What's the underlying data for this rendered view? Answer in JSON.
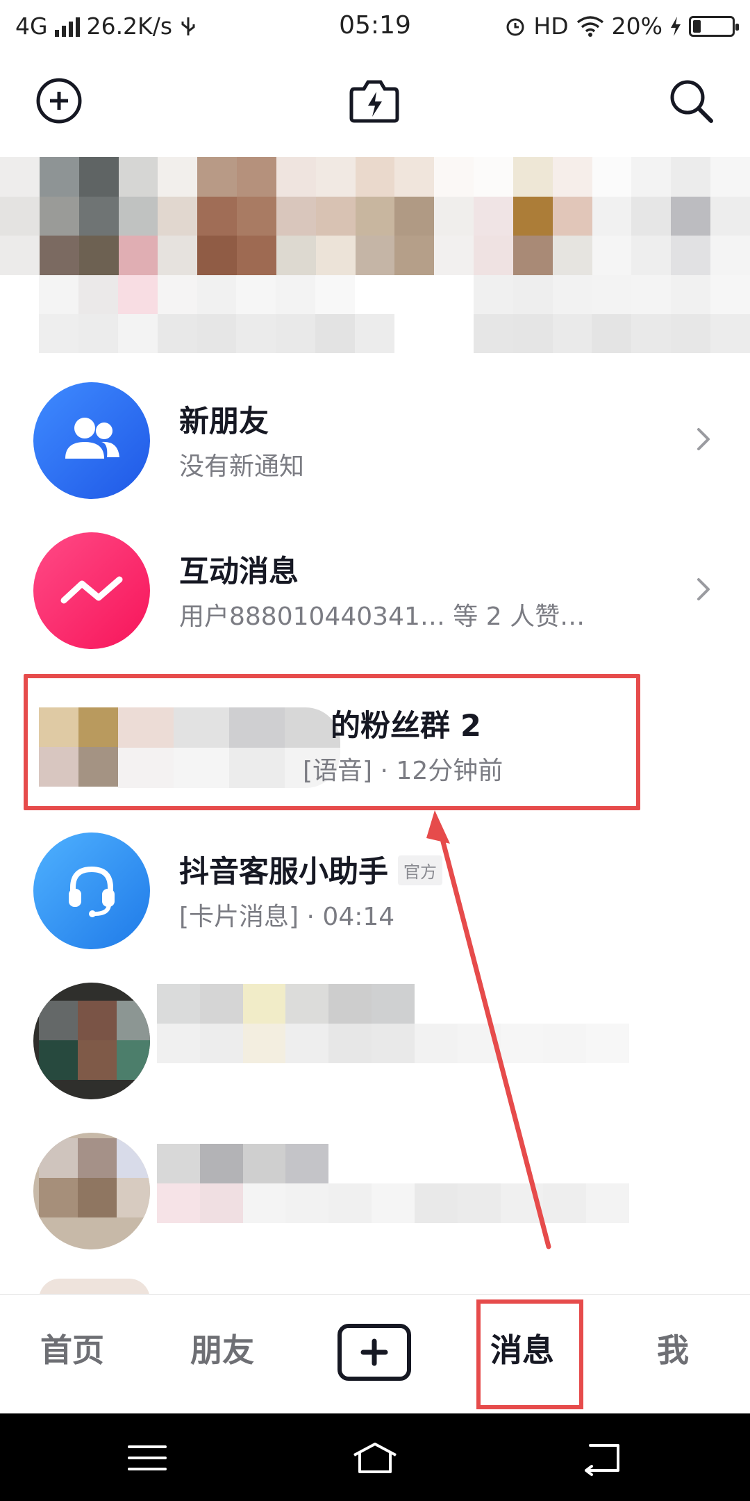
{
  "status_bar": {
    "network": "4G",
    "speed": "26.2K/s",
    "time": "05:19",
    "hd": "HD",
    "battery_percent": "20%",
    "battery_level": 0.2
  },
  "colors": {
    "accent_red": "#e64b4b",
    "new_friends_avatar": "#2f7cf6",
    "interaction_avatar": "#fb2b66",
    "service_avatar": "#2d8cf0"
  },
  "messages": [
    {
      "title": "新朋友",
      "subtitle": "没有新通知",
      "icon": "people-icon",
      "has_arrow": true
    },
    {
      "title": "互动消息",
      "subtitle": "用户888010440341… 等 2 人赞…",
      "icon": "zigzag-icon",
      "has_arrow": true
    },
    {
      "title": "的粉丝群 2",
      "subtitle": "[语音] · 12分钟前",
      "icon": "blurred-avatar"
    },
    {
      "title": "抖音客服小助手",
      "badge": "官方",
      "subtitle": "[卡片消息] · 04:14",
      "icon": "headset-icon"
    }
  ],
  "nav": {
    "home": "首页",
    "friends": "朋友",
    "messages": "消息",
    "me": "我",
    "active": "消息"
  }
}
